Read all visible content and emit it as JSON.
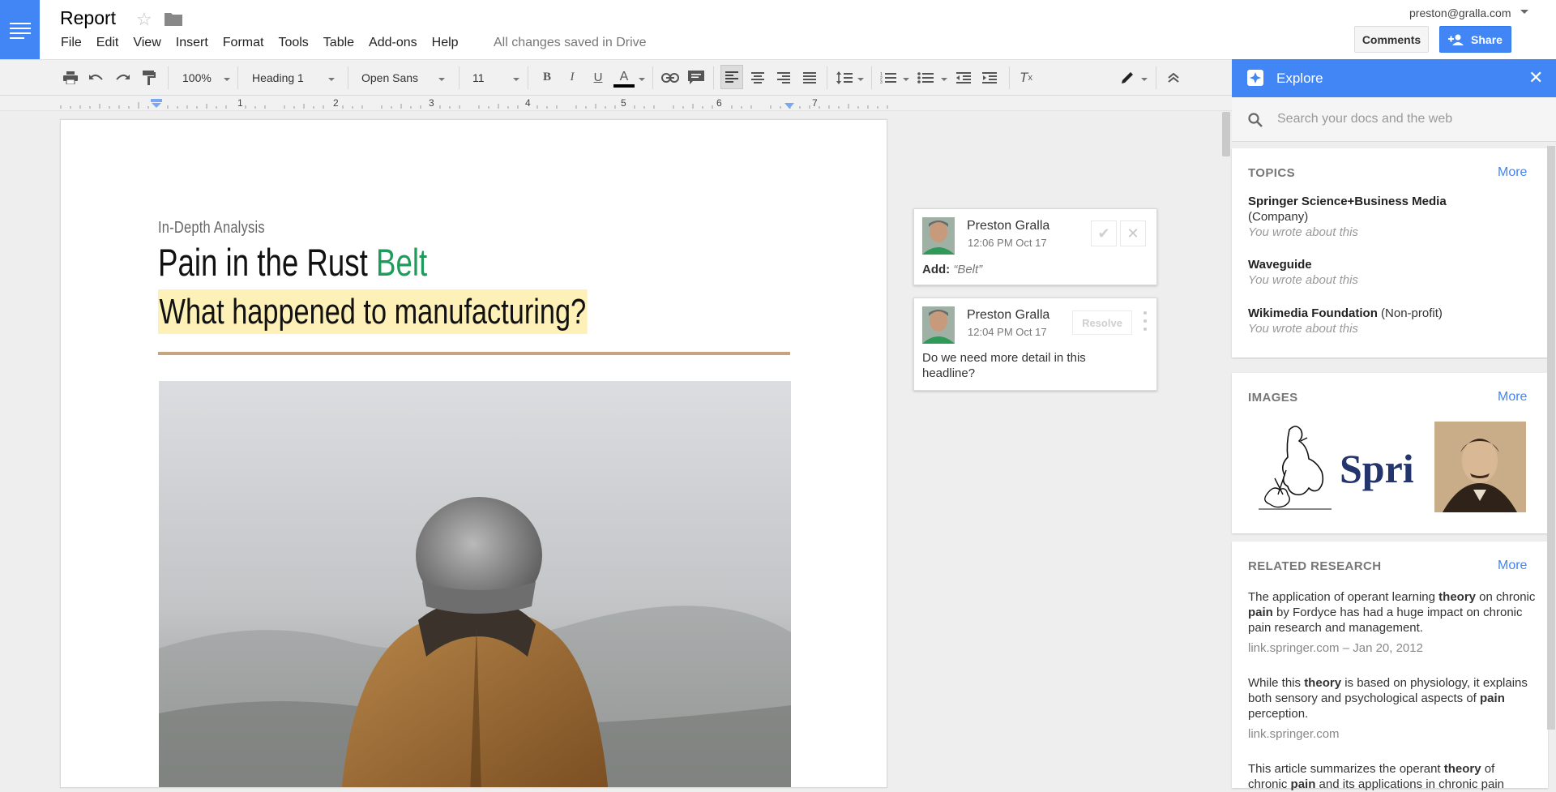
{
  "app": {
    "doc_title": "Report",
    "save_status": "All changes saved in Drive",
    "account": "preston@gralla.com",
    "comments_label": "Comments",
    "share_label": "Share",
    "menu": [
      "File",
      "Edit",
      "View",
      "Insert",
      "Format",
      "Tools",
      "Table",
      "Add-ons",
      "Help"
    ]
  },
  "toolbar": {
    "zoom": "100%",
    "style": "Heading 1",
    "font": "Open Sans",
    "size": "11",
    "text_color": "#000000"
  },
  "ruler": {
    "numbers": [
      "1",
      "2",
      "3",
      "4",
      "5",
      "6",
      "7"
    ]
  },
  "document": {
    "subtitle": "In-Depth Analysis",
    "headline_part1": "Pain in the Rust ",
    "headline_part2": "Belt",
    "subheadline": "What happened to manufacturing?",
    "highlight_color": "#fef1b8",
    "accent_green": "#1e9c5a",
    "divider_color": "#c5a47e"
  },
  "comments": [
    {
      "author": "Preston Gralla",
      "time": "12:06 PM Oct 17",
      "label": "Add:",
      "suggestion": "“Belt”"
    },
    {
      "author": "Preston Gralla",
      "time": "12:04 PM Oct 17",
      "resolve": "Resolve",
      "text": "Do we need more detail in this headline?"
    }
  ],
  "explore": {
    "title": "Explore",
    "search_placeholder": "Search your docs and the web",
    "more": "More",
    "topics": {
      "heading": "TOPICS",
      "items": [
        {
          "name": "Springer Science+Business Media",
          "type": "(Company)",
          "note": "You wrote about this"
        },
        {
          "name": "Waveguide",
          "type": "",
          "note": "You wrote about this"
        },
        {
          "name": "Wikimedia Foundation",
          "type": "(Non-profit)",
          "note": "You wrote about this"
        }
      ]
    },
    "images": {
      "heading": "IMAGES",
      "springer_text": "Sprir"
    },
    "research": {
      "heading": "RELATED RESEARCH",
      "items": [
        {
          "t1": "The application of operant learning ",
          "b1": "theory",
          "t2": " on chronic ",
          "b2": "pain",
          "t3": " by Fordyce has had a huge impact on chronic pain research and management.",
          "source": "link.springer.com – Jan 20, 2012"
        },
        {
          "t1": "While this ",
          "b1": "theory",
          "t2": " is based on physiology, it explains both sensory and psychological aspects of ",
          "b2": "pain",
          "t3": " perception.",
          "source": "link.springer.com"
        },
        {
          "t1": "This article summarizes the operant ",
          "b1": "theory",
          "t2": " of chronic ",
          "b2": "pain",
          "t3": " and its applications in chronic pain"
        }
      ]
    }
  }
}
